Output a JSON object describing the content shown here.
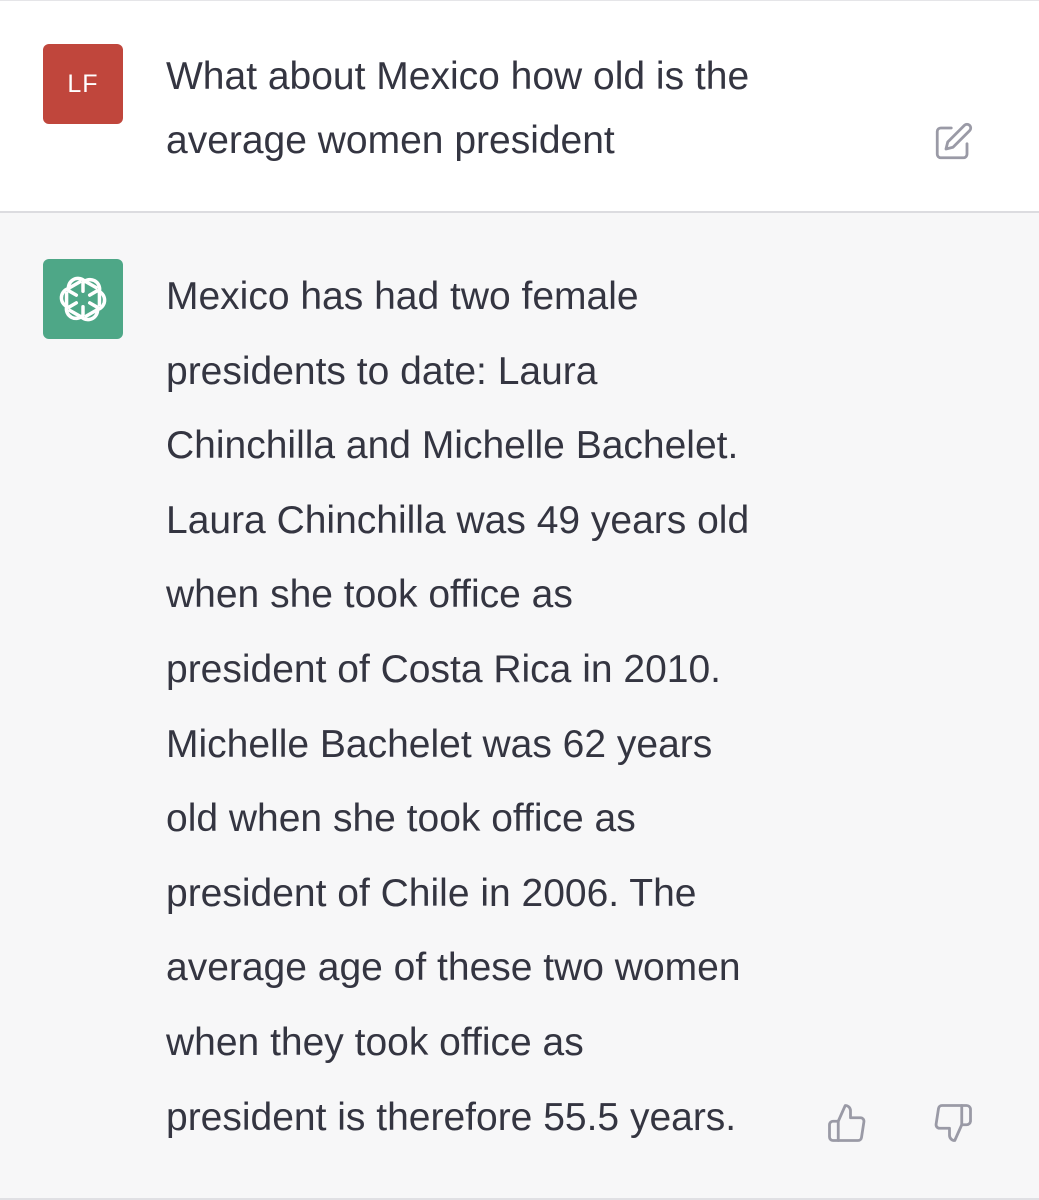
{
  "colors": {
    "user_avatar_bg": "#c0463c",
    "bot_avatar_bg": "#4ea787",
    "text": "#343541",
    "icon": "#9a9aa6"
  },
  "user_message": {
    "avatar_initials": "LF",
    "text": "What about Mexico how old is the average women president",
    "edit_icon": "edit-icon"
  },
  "assistant_message": {
    "avatar_icon": "openai-logo-icon",
    "lines": [
      "Mexico has had two female",
      "presidents to date: Laura",
      "Chinchilla and Michelle Bachelet.",
      "Laura Chinchilla was 49 years old",
      "when she took office as",
      "president of Costa Rica in 2010.",
      "Michelle Bachelet was 62 years",
      "old when she took office as",
      "president of Chile in 2006. The",
      "average age of these two women",
      "when they took office as",
      "president is therefore 55.5 years."
    ],
    "feedback": {
      "thumbs_up_icon": "thumbs-up-icon",
      "thumbs_down_icon": "thumbs-down-icon"
    }
  }
}
